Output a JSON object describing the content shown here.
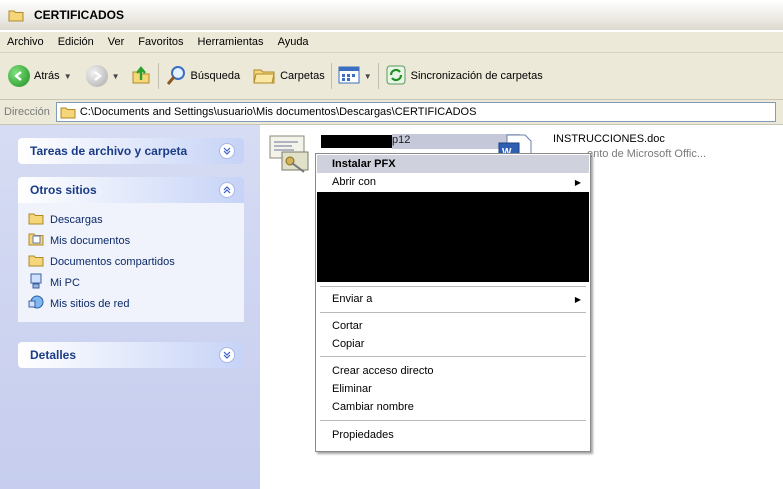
{
  "window": {
    "title": "CERTIFICADOS"
  },
  "menu": [
    "Archivo",
    "Edición",
    "Ver",
    "Favoritos",
    "Herramientas",
    "Ayuda"
  ],
  "toolbar": {
    "back": "Atrás",
    "search": "Búsqueda",
    "folders": "Carpetas",
    "sync": "Sincronización de carpetas"
  },
  "address": {
    "label": "Dirección",
    "path": "C:\\Documents and Settings\\usuario\\Mis documentos\\Descargas\\CERTIFICADOS"
  },
  "sidebar": {
    "tasks_title": "Tareas de archivo y carpeta",
    "other_title": "Otros sitios",
    "other_items": [
      "Descargas",
      "Mis documentos",
      "Documentos compartidos",
      "Mi PC",
      "Mis sitios de red"
    ],
    "details_title": "Detalles"
  },
  "files": {
    "cert_name_suffix": "p12",
    "doc_name": "INSTRUCCIONES.doc",
    "doc_type": "ento de Microsoft Offic..."
  },
  "context_menu": {
    "install": "Instalar PFX",
    "open_with": "Abrir con",
    "send_to": "Enviar a",
    "cut": "Cortar",
    "copy": "Copiar",
    "create_shortcut": "Crear acceso directo",
    "delete": "Eliminar",
    "rename": "Cambiar nombre",
    "properties": "Propiedades"
  }
}
